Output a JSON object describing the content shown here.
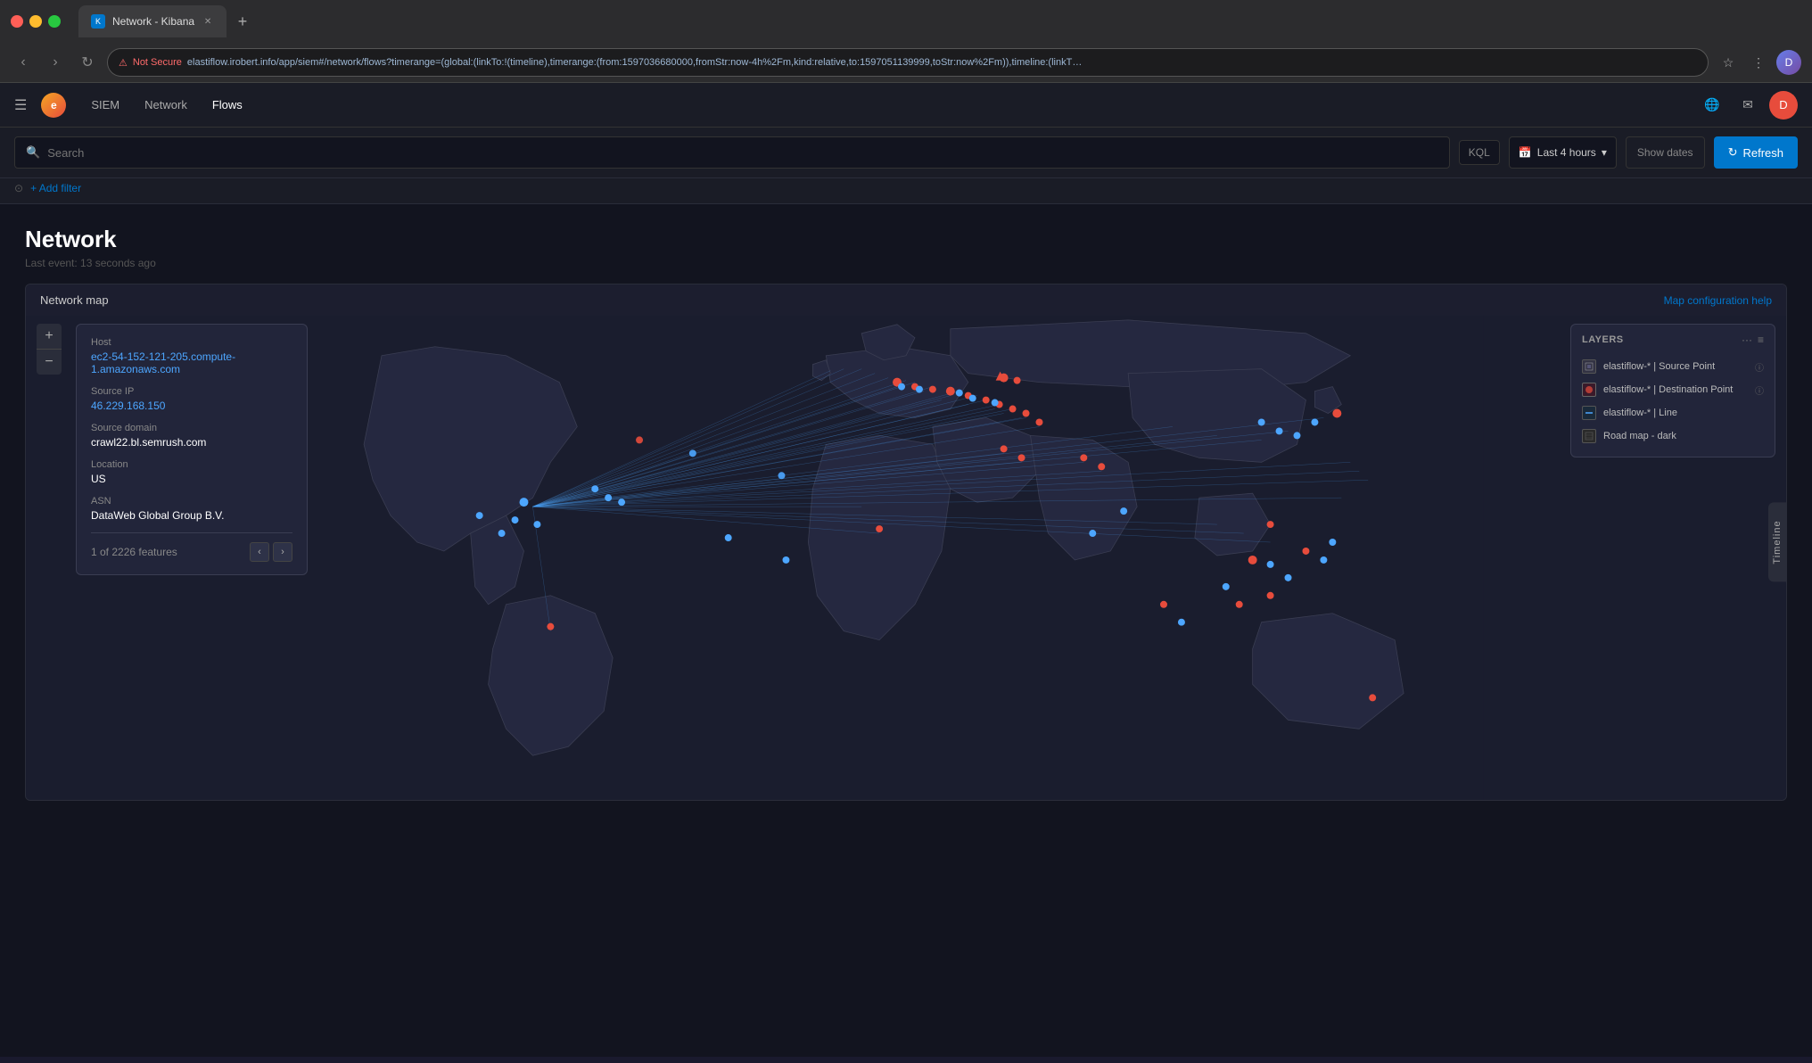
{
  "browser": {
    "tab_label": "Network - Kibana",
    "favicon_letter": "K",
    "close_symbol": "✕",
    "new_tab_symbol": "+",
    "back_symbol": "‹",
    "forward_symbol": "›",
    "reload_symbol": "↻",
    "lock_symbol": "⚠",
    "not_secure": "Not Secure",
    "url": "elastiflow.irobert.info/app/siem#/network/flows?timerange=(global:(linkTo:!(timeline),timerange:(from:1597036680000,fromStr:now-4h%2Fm,kind:relative,to:1597051139999,toStr:now%2Fm)),timeline:(linkT…",
    "star_symbol": "☆",
    "extensions_symbol": "⋮"
  },
  "app_header": {
    "menu_symbol": "☰",
    "logo_letter": "e",
    "nav_items": [
      {
        "label": "SIEM",
        "active": false
      },
      {
        "label": "Network",
        "active": false
      },
      {
        "label": "Flows",
        "active": true
      }
    ],
    "globe_symbol": "🌐",
    "mail_symbol": "✉",
    "user_letter": "D"
  },
  "search_bar": {
    "placeholder": "Search",
    "kql_label": "KQL",
    "calendar_symbol": "📅",
    "date_range": "Last 4 hours",
    "chevron": "▾",
    "show_dates_label": "Show dates",
    "refresh_label": "Refresh",
    "refresh_symbol": "↻",
    "filter_symbol": "⊙",
    "add_filter_label": "+ Add filter"
  },
  "page": {
    "title": "Network",
    "last_event": "Last event: 13 seconds ago"
  },
  "map": {
    "title": "Network map",
    "config_help": "Map configuration help",
    "zoom_plus": "+",
    "zoom_minus": "−",
    "more_symbol": "···",
    "list_symbol": "≡"
  },
  "popup": {
    "host_label": "Host",
    "host_value": "ec2-54-152-121-205.compute-1.amazonaws.com",
    "source_ip_label": "Source IP",
    "source_ip_value": "46.229.168.150",
    "source_domain_label": "Source domain",
    "source_domain_value": "crawl22.bl.semrush.com",
    "location_label": "Location",
    "location_value": "US",
    "asn_label": "ASN",
    "asn_value": "DataWeb Global Group B.V.",
    "feature_count": "1 of 2226 features",
    "prev_symbol": "‹",
    "next_symbol": "›"
  },
  "layers": {
    "title": "LAYERS",
    "items": [
      {
        "label": "elastiflow-* | Source Point",
        "icon": "source"
      },
      {
        "label": "elastiflow-* | Destination Point",
        "icon": "dest"
      },
      {
        "label": "elastiflow-* | Line",
        "icon": "line"
      },
      {
        "label": "Road map - dark",
        "icon": "map"
      }
    ],
    "info_symbol": "ⓘ"
  },
  "timeline": {
    "label": "Timeline"
  },
  "colors": {
    "accent_blue": "#4da6ff",
    "accent_red": "#e74c3c",
    "background": "#12141f",
    "surface": "#1a1c26",
    "panel": "#22253a",
    "border": "#2a2d3a",
    "text_primary": "#ffffff",
    "text_secondary": "#888888",
    "refresh_bg": "#0077cc"
  }
}
